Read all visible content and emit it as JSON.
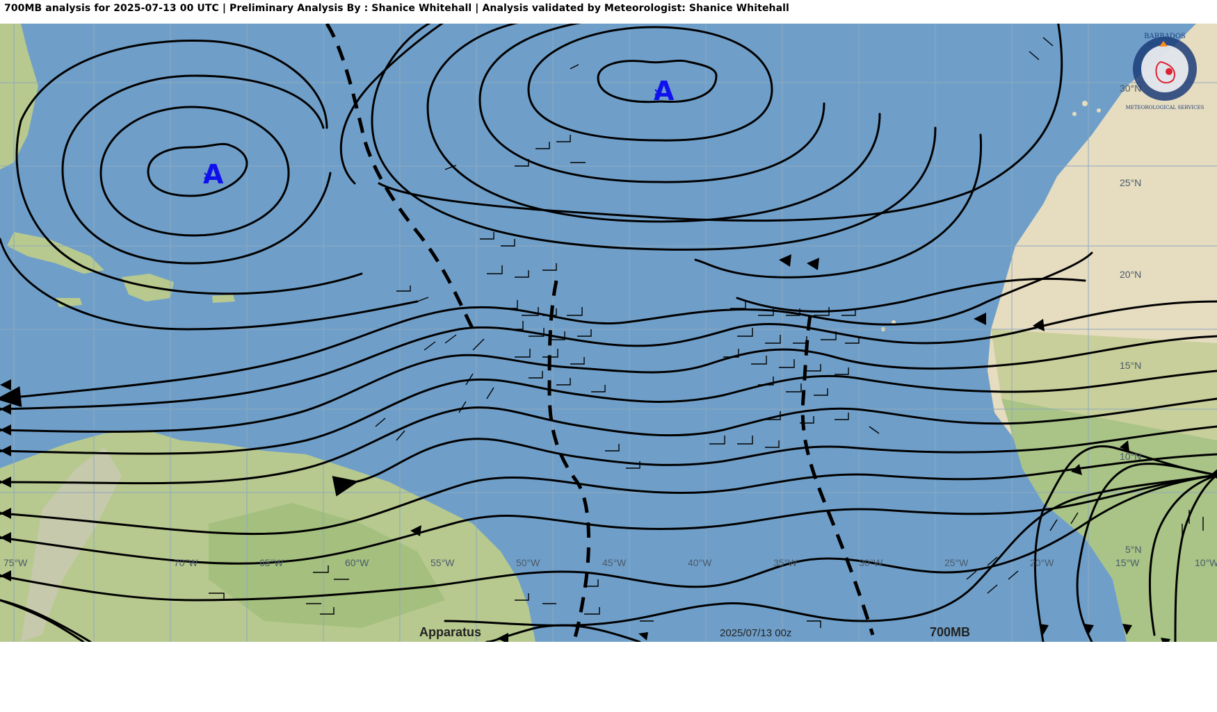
{
  "title": "700MB analysis for 2025-07-13 00 UTC | Preliminary Analysis By : Shanice Whitehall | Analysis validated by Meteorologist: Shanice Whitehall",
  "map": {
    "level_label": "700MB",
    "timestamp_label": "2025/07/13 00z",
    "watermark_label": "Apparatus",
    "high_markers": [
      "A",
      "A"
    ],
    "longitude_labels": [
      "75°W",
      "70°W",
      "65°W",
      "60°W",
      "55°W",
      "50°W",
      "45°W",
      "40°W",
      "35°W",
      "30°W",
      "25°W",
      "20°W",
      "15°W",
      "10°W"
    ],
    "latitude_labels": [
      "30°N",
      "25°N",
      "20°N",
      "15°N",
      "10°N",
      "5°N"
    ],
    "colors": {
      "ocean": "#6f9fc9",
      "land_green": "#b7c98e",
      "land_desert": "#e6dcc0",
      "streamline": "#000000",
      "high_marker": "#1010ee",
      "grid": "#8ea9c0"
    }
  },
  "logo": {
    "text_top": "BARBADOS",
    "text_bottom": "METEOROLOGICAL SERVICES"
  }
}
